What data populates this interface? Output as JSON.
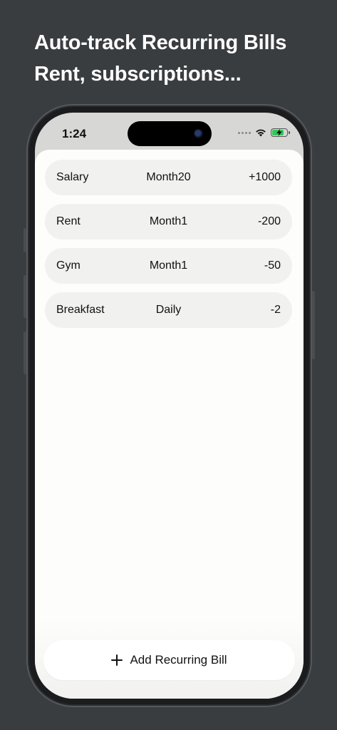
{
  "headline": {
    "line1": "Auto-track Recurring Bills",
    "line2": "Rent, subscriptions..."
  },
  "status_bar": {
    "time": "1:24",
    "icons": [
      "signal-dots-icon",
      "wifi-icon",
      "battery-charging-icon"
    ],
    "battery_color": "#34c759"
  },
  "bills": [
    {
      "name": "Salary",
      "frequency": "Month20",
      "amount": "+1000"
    },
    {
      "name": "Rent",
      "frequency": "Month1",
      "amount": "-200"
    },
    {
      "name": "Gym",
      "frequency": "Month1",
      "amount": "-50"
    },
    {
      "name": "Breakfast",
      "frequency": "Daily",
      "amount": "-2"
    }
  ],
  "add_button": {
    "icon": "plus-icon",
    "label": "Add Recurring Bill"
  }
}
